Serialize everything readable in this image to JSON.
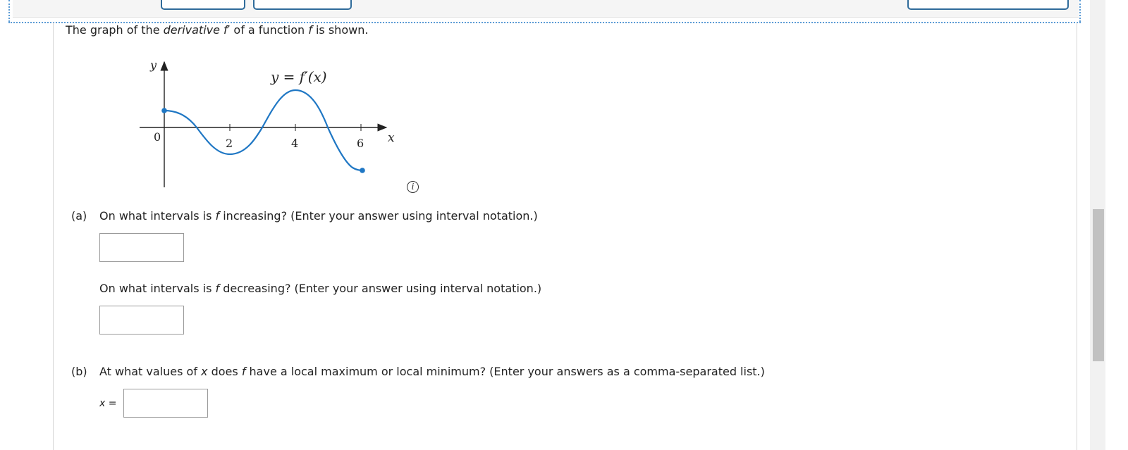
{
  "intro": {
    "before": "The graph of the ",
    "derivative_word": "derivative",
    "fprime": "f′",
    "middle": " of a function ",
    "f": "f",
    "after": " is shown."
  },
  "graph": {
    "curve_label": "y = f′(x)",
    "y_axis_label": "y",
    "x_axis_label": "x",
    "origin_label": "0",
    "tick_labels": [
      "2",
      "4",
      "6"
    ],
    "curve_color": "#1f77c4"
  },
  "info_icon": "i",
  "part_a": {
    "tag": "(a)",
    "q1_before": "On what intervals is ",
    "q1_var": "f",
    "q1_after": " increasing? (Enter your answer using interval notation.)",
    "q1_value": "",
    "q2_before": "On what intervals is ",
    "q2_var": "f",
    "q2_after": " decreasing? (Enter your answer using interval notation.)",
    "q2_value": ""
  },
  "part_b": {
    "tag": "(b)",
    "q_before": "At what values of ",
    "q_var_x": "x",
    "q_middle": " does ",
    "q_var_f": "f",
    "q_after": " have a local maximum or local minimum? (Enter your answers as a comma-separated list.)",
    "x_label_var": "x",
    "x_label_eq": " =",
    "value": ""
  },
  "colors": {
    "accent": "#2f6b9a",
    "dotted": "#5b9bd5"
  }
}
